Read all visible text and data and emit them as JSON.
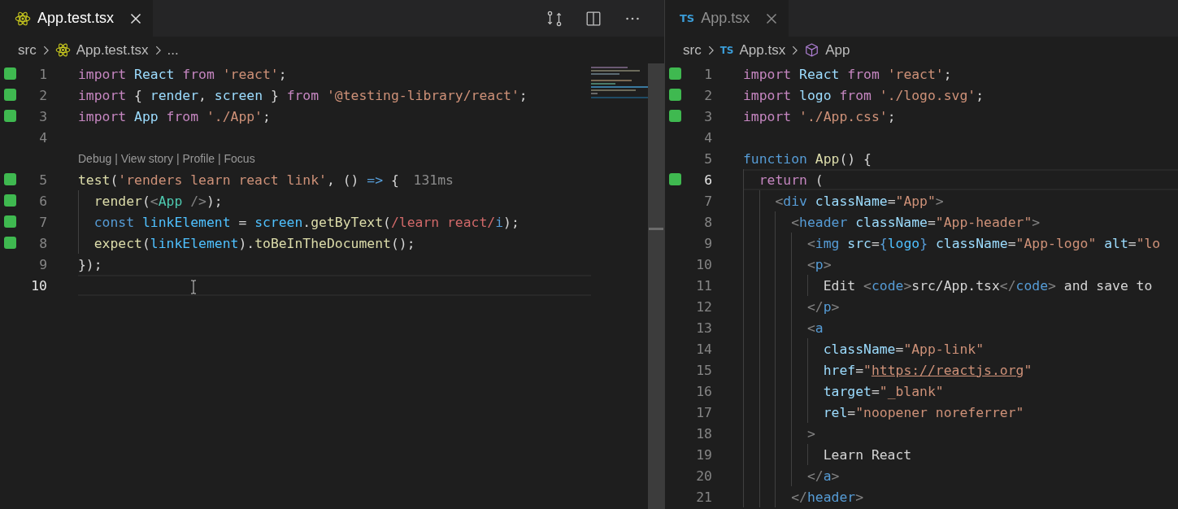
{
  "panes": [
    {
      "focused": true,
      "tab": {
        "label": "App.test.tsx",
        "kind": "react",
        "selected": true
      },
      "toolbar": true,
      "breadcrumb": [
        {
          "text": "src",
          "kind": "folder"
        },
        {
          "text": "App.test.tsx",
          "kind": "react"
        },
        {
          "text": "...",
          "kind": "more"
        }
      ],
      "minimap": true,
      "lines": [
        {
          "number": "1",
          "changed": true,
          "current": false,
          "tokens": [
            {
              "kind": "kw",
              "text": "import "
            },
            {
              "kind": "var",
              "text": "React "
            },
            {
              "kind": "kw",
              "text": "from "
            },
            {
              "kind": "str",
              "text": "'react'"
            },
            {
              "kind": "p",
              "text": ";"
            }
          ]
        },
        {
          "number": "2",
          "changed": true,
          "current": false,
          "tokens": [
            {
              "kind": "kw",
              "text": "import "
            },
            {
              "kind": "p",
              "text": "{ "
            },
            {
              "kind": "var",
              "text": "render"
            },
            {
              "kind": "p",
              "text": ", "
            },
            {
              "kind": "var",
              "text": "screen"
            },
            {
              "kind": "p",
              "text": " } "
            },
            {
              "kind": "kw",
              "text": "from "
            },
            {
              "kind": "str",
              "text": "'@testing-library/react'"
            },
            {
              "kind": "p",
              "text": ";"
            }
          ]
        },
        {
          "number": "3",
          "changed": true,
          "current": false,
          "tokens": [
            {
              "kind": "kw",
              "text": "import "
            },
            {
              "kind": "var",
              "text": "App "
            },
            {
              "kind": "kw",
              "text": "from "
            },
            {
              "kind": "str",
              "text": "'./App'"
            },
            {
              "kind": "p",
              "text": ";"
            }
          ]
        },
        {
          "number": "4",
          "changed": false,
          "current": false
        },
        {
          "number": "5",
          "changed": true,
          "current": false,
          "codelens": "Debug | View story | Profile | Focus",
          "tokens": [
            {
              "kind": "fn",
              "text": "test"
            },
            {
              "kind": "p",
              "text": "("
            },
            {
              "kind": "str",
              "text": "'renders learn react link'"
            },
            {
              "kind": "p",
              "text": ", () "
            },
            {
              "kind": "st",
              "text": "=>"
            },
            {
              "kind": "p",
              "text": " {"
            }
          ],
          "hint": "131ms"
        },
        {
          "number": "6",
          "changed": true,
          "current": false,
          "tokens": [
            {
              "kind": "fn",
              "text": "  render"
            },
            {
              "kind": "p",
              "text": "("
            },
            {
              "kind": "tp",
              "text": "<"
            },
            {
              "kind": "comp",
              "text": "App"
            },
            {
              "kind": "tp",
              "text": " />"
            },
            {
              "kind": "p",
              "text": ");"
            }
          ]
        },
        {
          "number": "7",
          "changed": true,
          "current": false,
          "tokens": [
            {
              "kind": "st",
              "text": "  const "
            },
            {
              "kind": "cn",
              "text": "linkElement "
            },
            {
              "kind": "p",
              "text": "= "
            },
            {
              "kind": "cn",
              "text": "screen"
            },
            {
              "kind": "p",
              "text": "."
            },
            {
              "kind": "fn",
              "text": "getByText"
            },
            {
              "kind": "p",
              "text": "("
            },
            {
              "kind": "rx",
              "text": "/learn react/"
            },
            {
              "kind": "st",
              "text": "i"
            },
            {
              "kind": "p",
              "text": ");"
            }
          ]
        },
        {
          "number": "8",
          "changed": true,
          "current": false,
          "tokens": [
            {
              "kind": "fn",
              "text": "  expect"
            },
            {
              "kind": "p",
              "text": "("
            },
            {
              "kind": "cn",
              "text": "linkElement"
            },
            {
              "kind": "p",
              "text": ")."
            },
            {
              "kind": "fn",
              "text": "toBeInTheDocument"
            },
            {
              "kind": "p",
              "text": "();"
            }
          ]
        },
        {
          "number": "9",
          "changed": false,
          "current": false,
          "tokens": [
            {
              "kind": "p",
              "text": "});"
            }
          ]
        },
        {
          "number": "10",
          "changed": false,
          "current": true
        }
      ]
    },
    {
      "focused": false,
      "tab": {
        "label": "App.tsx",
        "kind": "ts",
        "badge": "TS",
        "selected": true
      },
      "breadcrumb": [
        {
          "text": "src",
          "kind": "folder"
        },
        {
          "text": "App.tsx",
          "kind": "ts",
          "badge": "TS"
        },
        {
          "text": "App",
          "kind": "symbol"
        }
      ],
      "lines": [
        {
          "number": "1",
          "changed": true,
          "current": false,
          "tokens": [
            {
              "kind": "kw",
              "text": "import "
            },
            {
              "kind": "var",
              "text": "React "
            },
            {
              "kind": "kw",
              "text": "from "
            },
            {
              "kind": "str",
              "text": "'react'"
            },
            {
              "kind": "p",
              "text": ";"
            }
          ]
        },
        {
          "number": "2",
          "changed": true,
          "current": false,
          "tokens": [
            {
              "kind": "kw",
              "text": "import "
            },
            {
              "kind": "var",
              "text": "logo "
            },
            {
              "kind": "kw",
              "text": "from "
            },
            {
              "kind": "str",
              "text": "'./logo.svg'"
            },
            {
              "kind": "p",
              "text": ";"
            }
          ]
        },
        {
          "number": "3",
          "changed": true,
          "current": false,
          "tokens": [
            {
              "kind": "kw",
              "text": "import "
            },
            {
              "kind": "str",
              "text": "'./App.css'"
            },
            {
              "kind": "p",
              "text": ";"
            }
          ]
        },
        {
          "number": "4",
          "changed": false,
          "current": false
        },
        {
          "number": "5",
          "changed": false,
          "current": false,
          "tokens": [
            {
              "kind": "st",
              "text": "function "
            },
            {
              "kind": "fn",
              "text": "App"
            },
            {
              "kind": "p",
              "text": "() {"
            }
          ]
        },
        {
          "number": "6",
          "changed": true,
          "current": true,
          "tokens": [
            {
              "kind": "kw",
              "text": "  return "
            },
            {
              "kind": "p",
              "text": "("
            }
          ]
        },
        {
          "number": "7",
          "changed": false,
          "current": false,
          "tokens": [
            {
              "kind": "tp",
              "text": "    <"
            },
            {
              "kind": "tag",
              "text": "div "
            },
            {
              "kind": "var",
              "text": "className"
            },
            {
              "kind": "p",
              "text": "="
            },
            {
              "kind": "str",
              "text": "\"App\""
            },
            {
              "kind": "tp",
              "text": ">"
            }
          ]
        },
        {
          "number": "8",
          "changed": false,
          "current": false,
          "tokens": [
            {
              "kind": "tp",
              "text": "      <"
            },
            {
              "kind": "tag",
              "text": "header "
            },
            {
              "kind": "var",
              "text": "className"
            },
            {
              "kind": "p",
              "text": "="
            },
            {
              "kind": "str",
              "text": "\"App-header\""
            },
            {
              "kind": "tp",
              "text": ">"
            }
          ]
        },
        {
          "number": "9",
          "changed": false,
          "current": false,
          "tokens": [
            {
              "kind": "tp",
              "text": "        <"
            },
            {
              "kind": "tag",
              "text": "img "
            },
            {
              "kind": "var",
              "text": "src"
            },
            {
              "kind": "p",
              "text": "="
            },
            {
              "kind": "tag",
              "text": "{"
            },
            {
              "kind": "cn",
              "text": "logo"
            },
            {
              "kind": "tag",
              "text": "} "
            },
            {
              "kind": "var",
              "text": "className"
            },
            {
              "kind": "p",
              "text": "="
            },
            {
              "kind": "str",
              "text": "\"App-logo\" "
            },
            {
              "kind": "var",
              "text": "alt"
            },
            {
              "kind": "p",
              "text": "="
            },
            {
              "kind": "str",
              "text": "\"lo"
            }
          ]
        },
        {
          "number": "10",
          "changed": false,
          "current": false,
          "tokens": [
            {
              "kind": "tp",
              "text": "        <"
            },
            {
              "kind": "tag",
              "text": "p"
            },
            {
              "kind": "tp",
              "text": ">"
            }
          ]
        },
        {
          "number": "11",
          "changed": false,
          "current": false,
          "tokens": [
            {
              "kind": "txt",
              "text": "          Edit "
            },
            {
              "kind": "tp",
              "text": "<"
            },
            {
              "kind": "tag",
              "text": "code"
            },
            {
              "kind": "tp",
              "text": ">"
            },
            {
              "kind": "txt",
              "text": "src/App.tsx"
            },
            {
              "kind": "tp",
              "text": "</"
            },
            {
              "kind": "tag",
              "text": "code"
            },
            {
              "kind": "tp",
              "text": ">"
            },
            {
              "kind": "txt",
              "text": " and save to"
            }
          ]
        },
        {
          "number": "12",
          "changed": false,
          "current": false,
          "tokens": [
            {
              "kind": "tp",
              "text": "        </"
            },
            {
              "kind": "tag",
              "text": "p"
            },
            {
              "kind": "tp",
              "text": ">"
            }
          ]
        },
        {
          "number": "13",
          "changed": false,
          "current": false,
          "tokens": [
            {
              "kind": "tp",
              "text": "        <"
            },
            {
              "kind": "tag",
              "text": "a"
            }
          ]
        },
        {
          "number": "14",
          "changed": false,
          "current": false,
          "tokens": [
            {
              "kind": "var",
              "text": "          className"
            },
            {
              "kind": "p",
              "text": "="
            },
            {
              "kind": "str",
              "text": "\"App-link\""
            }
          ]
        },
        {
          "number": "15",
          "changed": false,
          "current": false,
          "tokens": [
            {
              "kind": "var",
              "text": "          href"
            },
            {
              "kind": "p",
              "text": "="
            },
            {
              "kind": "str",
              "text": "\""
            },
            {
              "kind": "link",
              "text": "https://reactjs.org"
            },
            {
              "kind": "str",
              "text": "\""
            }
          ]
        },
        {
          "number": "16",
          "changed": false,
          "current": false,
          "tokens": [
            {
              "kind": "var",
              "text": "          target"
            },
            {
              "kind": "p",
              "text": "="
            },
            {
              "kind": "str",
              "text": "\"_blank\""
            }
          ]
        },
        {
          "number": "17",
          "changed": false,
          "current": false,
          "tokens": [
            {
              "kind": "var",
              "text": "          rel"
            },
            {
              "kind": "p",
              "text": "="
            },
            {
              "kind": "str",
              "text": "\"noopener noreferrer\""
            }
          ]
        },
        {
          "number": "18",
          "changed": false,
          "current": false,
          "tokens": [
            {
              "kind": "tp",
              "text": "        >"
            }
          ]
        },
        {
          "number": "19",
          "changed": false,
          "current": false,
          "tokens": [
            {
              "kind": "txt",
              "text": "          Learn React"
            }
          ]
        },
        {
          "number": "20",
          "changed": false,
          "current": false,
          "tokens": [
            {
              "kind": "tp",
              "text": "        </"
            },
            {
              "kind": "tag",
              "text": "a"
            },
            {
              "kind": "tp",
              "text": ">"
            }
          ]
        },
        {
          "number": "21",
          "changed": false,
          "current": false,
          "tokens": [
            {
              "kind": "tp",
              "text": "      </"
            },
            {
              "kind": "tag",
              "text": "header"
            },
            {
              "kind": "tp",
              "text": ">"
            }
          ]
        }
      ]
    }
  ]
}
